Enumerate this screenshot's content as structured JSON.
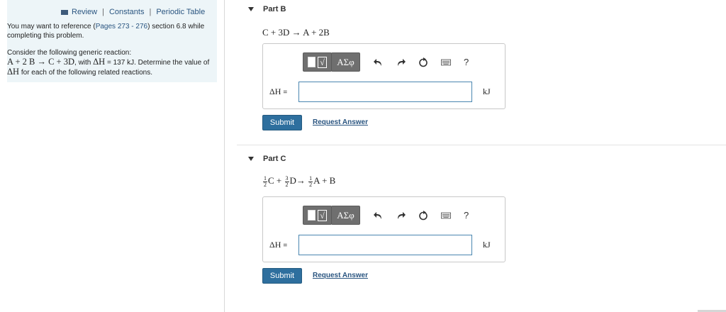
{
  "left": {
    "nav": {
      "review": "Review",
      "constants": "Constants",
      "periodic_table": "Periodic Table",
      "separator": "|"
    },
    "reference": {
      "prefix": "You may want to reference (",
      "pages": "Pages 273 - 276",
      "suffix": ") section 6.8 while completing this problem."
    },
    "intro": {
      "line1": "Consider the following generic reaction:",
      "reaction": "A + 2 B → C + 3D",
      "with": ", with",
      "dh": "ΔH",
      "eq_value": " = 137 kJ",
      "determine": ". Determine the value of",
      "dh2": "ΔH",
      "tail": "for each of the following related reactions."
    }
  },
  "parts": [
    {
      "title": "Part B",
      "equation": "C + 3D → A + 2B",
      "toolbar": {
        "templates_symbol": "√",
        "symbols_label": "ΑΣφ",
        "help": "?"
      },
      "dh_label": "ΔH",
      "dh_eq": "=",
      "input_value": "",
      "unit": "kJ",
      "submit": "Submit",
      "request": "Request Answer"
    },
    {
      "title": "Part C",
      "equation": {
        "f1_num": "1",
        "f1_den": "2",
        "t1": "C +",
        "f2_num": "3",
        "f2_den": "2",
        "t2": "D→",
        "f3_num": "1",
        "f3_den": "2",
        "t3": "A + B"
      },
      "toolbar": {
        "templates_symbol": "√",
        "symbols_label": "ΑΣφ",
        "help": "?"
      },
      "dh_label": "ΔH",
      "dh_eq": "=",
      "input_value": "",
      "unit": "kJ",
      "submit": "Submit",
      "request": "Request Answer"
    }
  ],
  "colors": {
    "panel_bg": "#edf5f8",
    "link": "#2a5580",
    "submit_bg": "#2e6f9e",
    "input_border": "#4a86b0",
    "toolbar_btn": "#6f6f6f"
  },
  "icons": [
    "list-icon",
    "collapse-triangle-icon",
    "templates-icon",
    "symbols-icon",
    "undo-icon",
    "redo-icon",
    "reset-icon",
    "keyboard-icon",
    "help-icon"
  ]
}
